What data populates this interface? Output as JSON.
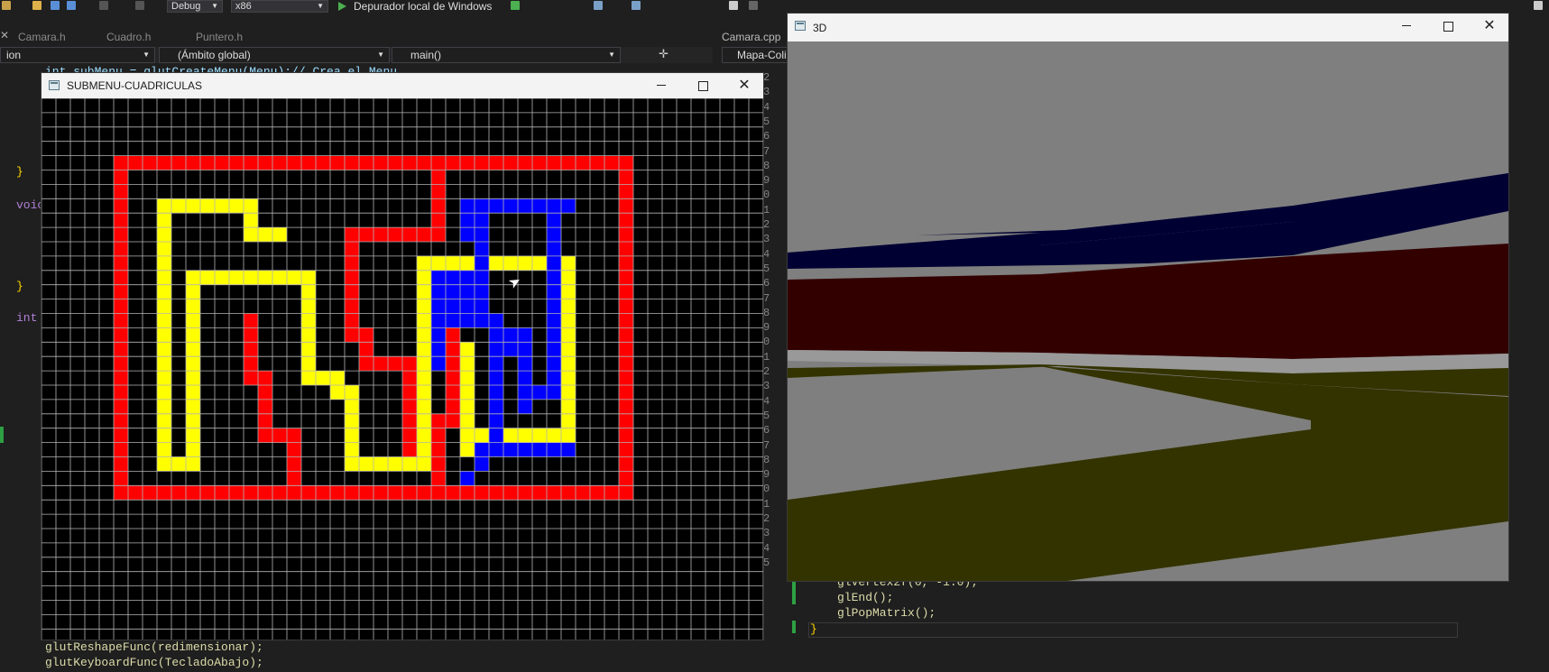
{
  "ide": {
    "toolbar": {
      "configuration": "Debug",
      "platform": "x86",
      "debugger": "Depurador local de Windows"
    },
    "tabs": [
      {
        "label": "Camara.h"
      },
      {
        "label": "Cuadro.h"
      },
      {
        "label": "Puntero.h"
      },
      {
        "label": "Camara.cpp"
      }
    ],
    "navbar": {
      "left": "ion",
      "scope": "(Ámbito global)",
      "function": "main()",
      "right_file": "Mapa-Coli"
    },
    "code": {
      "line_top": "int subMenu = glutCreateMenu(Menu);// Crea el Menu",
      "brace1": "}",
      "void_kw": "voic",
      "brace2": "}",
      "int_kw": "int",
      "bottom1": "glutReshapeFunc(redimensionar);",
      "bottom2": "glutKeyboardFunc(TecladoAbajo);",
      "right1": "glVertex2f(0, -1.0);",
      "right2": "glEnd();",
      "right3": "glPopMatrix();",
      "right4": "}"
    },
    "line_number_digits": [
      "2",
      "3",
      "4",
      "5",
      "6",
      "7",
      "8",
      "9",
      "0",
      "1",
      "2",
      "3",
      "4",
      "5",
      "6",
      "7",
      "8",
      "9",
      "0",
      "1",
      "2",
      "3",
      "4",
      "5",
      "6",
      "7",
      "8",
      "9",
      "0",
      "1",
      "2",
      "3",
      "4",
      "5"
    ]
  },
  "grid_window": {
    "title": "SUBMENU-CUADRICULAS",
    "grid": {
      "columns": 50,
      "rows": 37,
      "line_color": "#b4b4b4",
      "background": "#000000",
      "colors": {
        "red": "#ff0000",
        "yellow": "#ffff00",
        "blue": "#0000ff"
      },
      "red_segments": [
        [
          5,
          4,
          40,
          4
        ],
        [
          5,
          4,
          5,
          27
        ],
        [
          5,
          27,
          40,
          27
        ],
        [
          40,
          4,
          40,
          27
        ],
        [
          27,
          4,
          27,
          9
        ],
        [
          21,
          9,
          27,
          9
        ],
        [
          21,
          9,
          21,
          16
        ],
        [
          21,
          16,
          22,
          16
        ],
        [
          22,
          16,
          22,
          18
        ],
        [
          22,
          18,
          25,
          18
        ],
        [
          25,
          18,
          25,
          24
        ],
        [
          28,
          16,
          28,
          22
        ],
        [
          27,
          22,
          28,
          22
        ],
        [
          27,
          22,
          27,
          27
        ],
        [
          14,
          15,
          14,
          19
        ],
        [
          14,
          19,
          15,
          19
        ],
        [
          15,
          19,
          15,
          23
        ],
        [
          15,
          23,
          17,
          23
        ],
        [
          17,
          23,
          17,
          27
        ]
      ],
      "yellow_segments": [
        [
          8,
          7,
          14,
          7
        ],
        [
          8,
          7,
          8,
          25
        ],
        [
          8,
          25,
          10,
          25
        ],
        [
          14,
          7,
          14,
          9
        ],
        [
          14,
          9,
          16,
          9
        ],
        [
          10,
          12,
          18,
          12
        ],
        [
          10,
          12,
          10,
          25
        ],
        [
          18,
          12,
          18,
          19
        ],
        [
          18,
          19,
          20,
          19
        ],
        [
          20,
          19,
          20,
          20
        ],
        [
          20,
          20,
          21,
          20
        ],
        [
          21,
          20,
          21,
          25
        ],
        [
          21,
          25,
          26,
          25
        ],
        [
          26,
          11,
          26,
          25
        ],
        [
          26,
          11,
          36,
          11
        ],
        [
          36,
          11,
          36,
          23
        ],
        [
          36,
          23,
          30,
          23
        ],
        [
          29,
          17,
          29,
          24
        ],
        [
          30,
          23,
          30,
          24
        ]
      ],
      "blue_segments": [
        [
          29,
          7,
          36,
          7
        ],
        [
          29,
          7,
          29,
          9
        ],
        [
          29,
          9,
          30,
          9
        ],
        [
          30,
          8,
          30,
          11
        ],
        [
          35,
          7,
          35,
          20
        ],
        [
          33,
          20,
          35,
          20
        ],
        [
          33,
          16,
          33,
          21
        ],
        [
          32,
          16,
          33,
          16
        ],
        [
          32,
          16,
          32,
          17
        ],
        [
          31,
          15,
          31,
          23
        ],
        [
          30,
          24,
          36,
          24
        ],
        [
          30,
          24,
          30,
          25
        ],
        [
          29,
          26,
          29,
          26
        ],
        [
          27,
          12,
          27,
          18
        ]
      ],
      "blue_block": [
        27,
        12,
        30,
        15
      ]
    }
  },
  "view3d_window": {
    "title": "3D",
    "colors": {
      "sky": "#7f7f7f",
      "floor": "#7f7f7f",
      "navy": "#000033",
      "maroon": "#330000",
      "olive": "#333300",
      "pale": "#999999"
    }
  }
}
